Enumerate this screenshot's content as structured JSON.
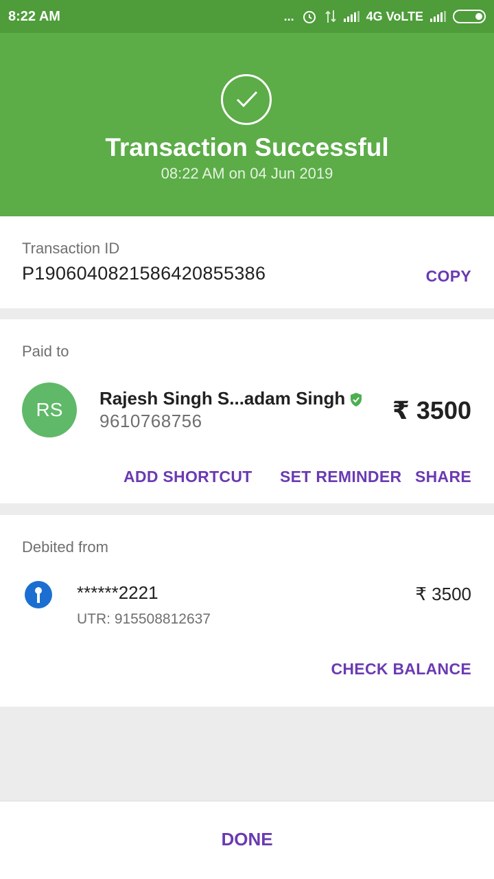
{
  "status_bar": {
    "time": "8:22 AM",
    "dots": "...",
    "network": "4G VoLTE"
  },
  "header": {
    "title": "Transaction Successful",
    "subtitle": "08:22 AM on 04 Jun 2019",
    "icon": "check-circle-icon",
    "background_color": "#5cac48"
  },
  "transaction": {
    "label": "Transaction ID",
    "id": "P1906040821586420855386",
    "copy_label": "COPY"
  },
  "paid_to": {
    "label": "Paid to",
    "initials": "RS",
    "name": "Rajesh Singh S...adam Singh",
    "phone": "9610768756",
    "amount": "₹ 3500",
    "actions": {
      "add_shortcut": "ADD SHORTCUT",
      "set_reminder": "SET REMINDER",
      "share": "SHARE"
    }
  },
  "debited_from": {
    "label": "Debited from",
    "account": "******2221",
    "utr": "UTR: 915508812637",
    "amount": "₹ 3500",
    "check_balance": "CHECK BALANCE"
  },
  "footer": {
    "done_label": "DONE"
  },
  "colors": {
    "accent": "#6a3ab2",
    "success": "#5cac48",
    "avatar": "#5fb968",
    "bank": "#1c6fd1"
  }
}
